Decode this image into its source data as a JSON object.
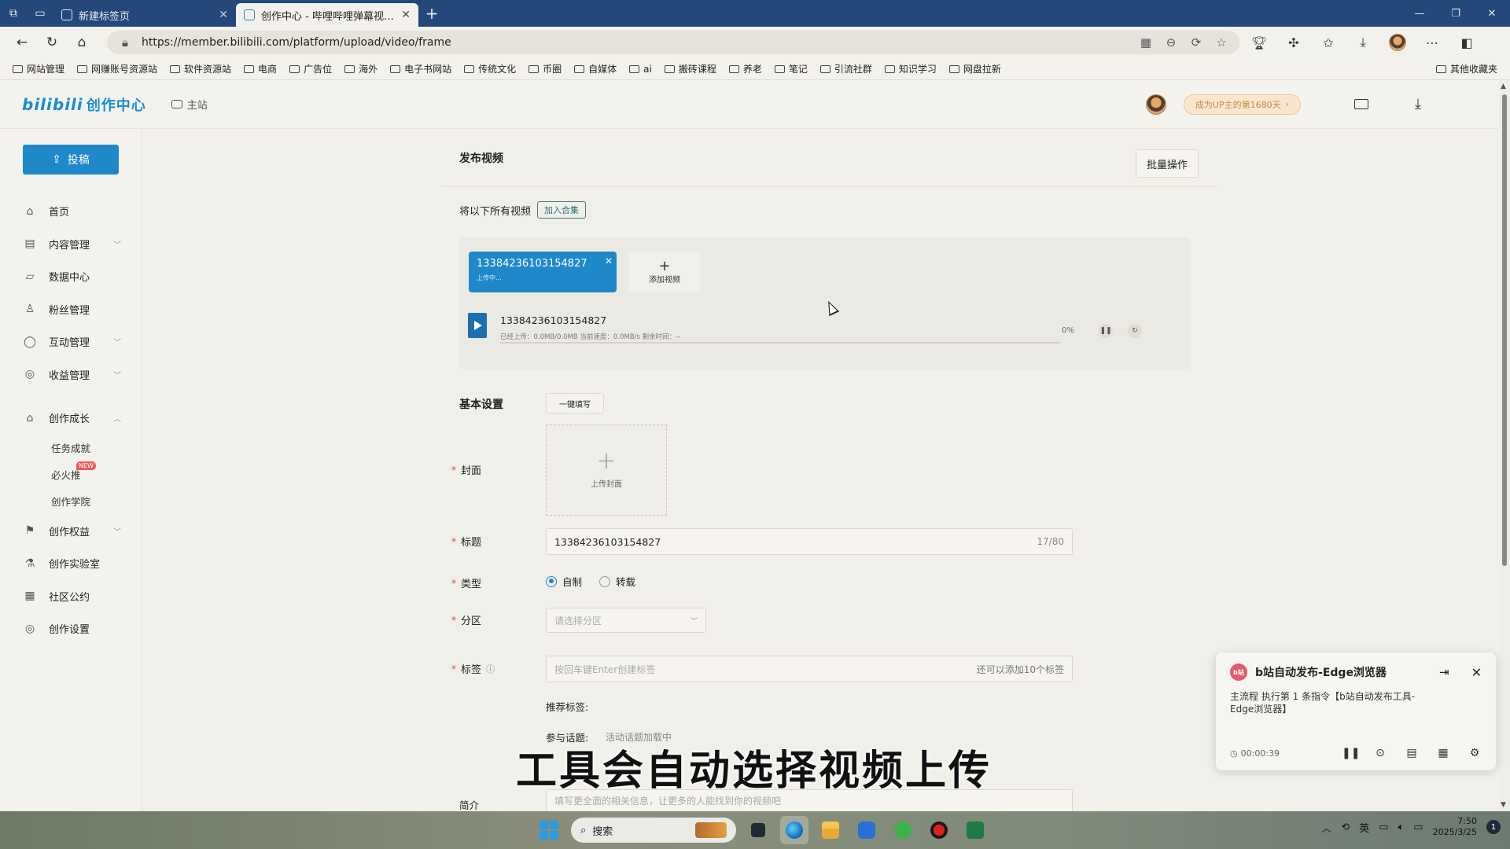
{
  "browser": {
    "tabs": [
      {
        "title": "新建标签页",
        "active": false
      },
      {
        "title": "创作中心 - 哔哩哔哩弹幕视频网 -",
        "active": true
      }
    ],
    "url": "https://member.bilibili.com/platform/upload/video/frame",
    "bookmarks": [
      "网站管理",
      "网赚账号资源站",
      "软件资源站",
      "电商",
      "广告位",
      "海外",
      "电子书网站",
      "传统文化",
      "币圈",
      "自媒体",
      "ai",
      "搬砖课程",
      "养老",
      "笔记",
      "引流社群",
      "知识学习",
      "网盘拉新"
    ],
    "other_bookmarks": "其他收藏夹"
  },
  "topnav": {
    "logo": "bilibili",
    "logo_suffix": "创作中心",
    "main_site": "主站",
    "up_pill": "成为UP主的第1680天"
  },
  "sidebar": {
    "upload_label": "投稿",
    "items": [
      {
        "label": "首页",
        "icon": "home-icon",
        "chevron": false
      },
      {
        "label": "内容管理",
        "icon": "document-icon",
        "chevron": true
      },
      {
        "label": "数据中心",
        "icon": "chart-icon",
        "chevron": false
      },
      {
        "label": "粉丝管理",
        "icon": "user-icon",
        "chevron": false
      },
      {
        "label": "互动管理",
        "icon": "chat-icon",
        "chevron": true
      },
      {
        "label": "收益管理",
        "icon": "money-icon",
        "chevron": true
      },
      {
        "label": "创作成长",
        "icon": "graduation-icon",
        "chevron": true
      }
    ],
    "sub_items": [
      "任务成就",
      "必火推",
      "创作学院"
    ],
    "new_badge": "NEW",
    "items2": [
      {
        "label": "创作权益",
        "icon": "flag-icon",
        "chevron": true
      },
      {
        "label": "创作实验室",
        "icon": "flask-icon",
        "chevron": false
      },
      {
        "label": "社区公约",
        "icon": "rules-icon",
        "chevron": false
      },
      {
        "label": "创作设置",
        "icon": "settings-icon",
        "chevron": false
      }
    ]
  },
  "main": {
    "title": "发布视频",
    "batch": "批量操作",
    "collection_text": "将以下所有视频",
    "collection_button": "加入合集",
    "video_card": {
      "name": "13384236103154827",
      "status": "上传中..."
    },
    "add_video": "添加视频",
    "file": {
      "name": "13384236103154827",
      "stats": "已经上传：0.0MB/0.0MB  当前速度：0.0MB/s  剩余时间：--",
      "percent": "0%",
      "progress": 0
    },
    "basic_settings": "基本设置",
    "quick_fill": "一键填写",
    "cover_label": "封面",
    "cover_upload": "上传封面",
    "title_label": "标题",
    "title_value": "13384236103154827",
    "title_count": "17/80",
    "type_label": "类型",
    "type_options": [
      "自制",
      "转载"
    ],
    "zone_label": "分区",
    "zone_placeholder": "请选择分区",
    "tag_label": "标签",
    "tag_placeholder": "按回车键Enter创建标签",
    "tag_hint": "还可以添加10个标签",
    "recommend_tags": "推荐标签:",
    "topics_label": "参与话题:",
    "topics_loading": "活动话题加载中",
    "intro_label": "简介",
    "intro_placeholder": "填写更全面的相关信息，让更多的人能找到你的视频吧"
  },
  "overlay_subtitle": "工具会自动选择视频上传",
  "popup": {
    "logo": "b站",
    "title": "b站自动发布-Edge浏览器",
    "body": "主流程 执行第 1 条指令【b站自动发布工具-Edge浏览器】",
    "timer": "00:00:39"
  },
  "taskbar": {
    "search": "搜索",
    "ime": "英",
    "time": "7:50",
    "date": "2025/3/25",
    "notifications": "1"
  },
  "colors": {
    "brand": "#1e88c8",
    "tabbar": "#24487a"
  }
}
